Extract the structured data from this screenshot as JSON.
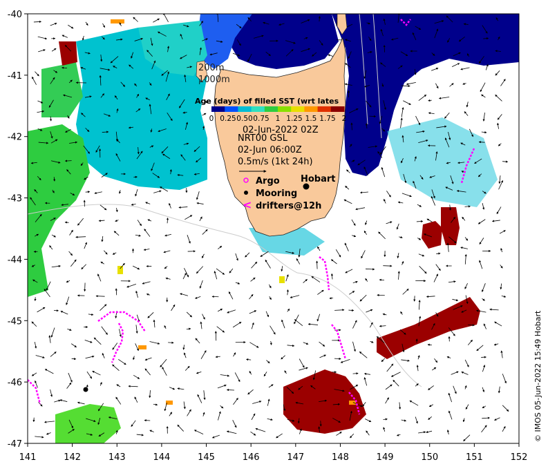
{
  "axes": {
    "x_ticks": [
      "141",
      "142",
      "143",
      "144",
      "145",
      "146",
      "147",
      "148",
      "149",
      "150",
      "151",
      "152"
    ],
    "y_ticks": [
      "-40",
      "-41",
      "-42",
      "-43",
      "-44",
      "-45",
      "-46",
      "-47"
    ],
    "lon_range": [
      141,
      152
    ],
    "lat_range": [
      -47,
      -40
    ]
  },
  "overlay": {
    "depth_200": "200m",
    "depth_1000": "1000m",
    "colorbar_title": "Age (days) of filled SST (wrt lates",
    "colorbar_ticks": [
      "0",
      "0.25",
      "0.50",
      "0.75",
      "1",
      "1.25",
      "1.5",
      "1.75",
      "2"
    ],
    "colorbar_colors": [
      "#00008b",
      "#0050ff",
      "#00bcd4",
      "#30e0c0",
      "#2ecc40",
      "#8ae000",
      "#e8e000",
      "#ff9800",
      "#e03000",
      "#8b0000"
    ],
    "sst_time": "02-Jun-2022 02Z",
    "current_product": "NRT00 GSL",
    "current_time": "02-Jun 06:00Z",
    "arrow_scale": "0.5m/s (1kt 24h)",
    "legend": {
      "argo": "Argo",
      "mooring": "Mooring",
      "drifters": "drifters@12h"
    },
    "city": "Hobart"
  },
  "credit": "© IMOS 05-Jun-2022 15:49 Hobart",
  "colors": {
    "land": "#f9c99b",
    "drifter": "#ff00ff",
    "argo": "#ff00ff",
    "age_0": "#00008b",
    "age_025": "#0050ff",
    "age_05": "#00bcd4",
    "age_075": "#2ecc40",
    "age_1": "#8ae000",
    "age_15": "#ff9800",
    "age_2": "#8b0000"
  }
}
